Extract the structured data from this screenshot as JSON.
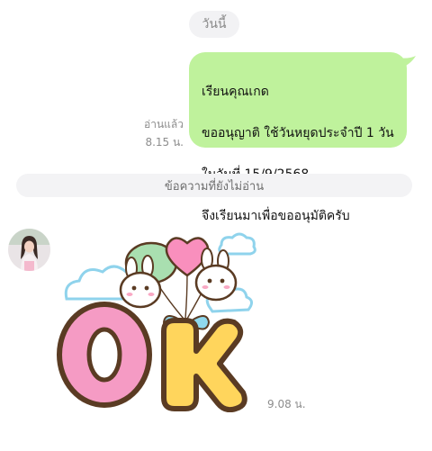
{
  "chat": {
    "date_label": "วันนี้",
    "outgoing_message": {
      "lines": [
        "เรียนคุณเกด",
        "ขออนุญาติ ใช้วันหยุดประจำปี 1 วัน",
        "ในวันที่ 15/9/2568",
        "จึงเรียนมาเพื่อขออนุมัติครับ"
      ],
      "read_status": "อ่านแล้ว",
      "time": "8.15 น."
    },
    "unread_divider": "ข้อความที่ยังไม่อ่าน",
    "incoming_message": {
      "sticker_letters": "OK",
      "time": "9.08 น."
    }
  },
  "colors": {
    "bubble_outgoing": "#bff29c",
    "sticker_o_fill": "#f59bc4",
    "sticker_k_fill": "#ffd55c",
    "sticker_outline": "#5a3b23"
  }
}
